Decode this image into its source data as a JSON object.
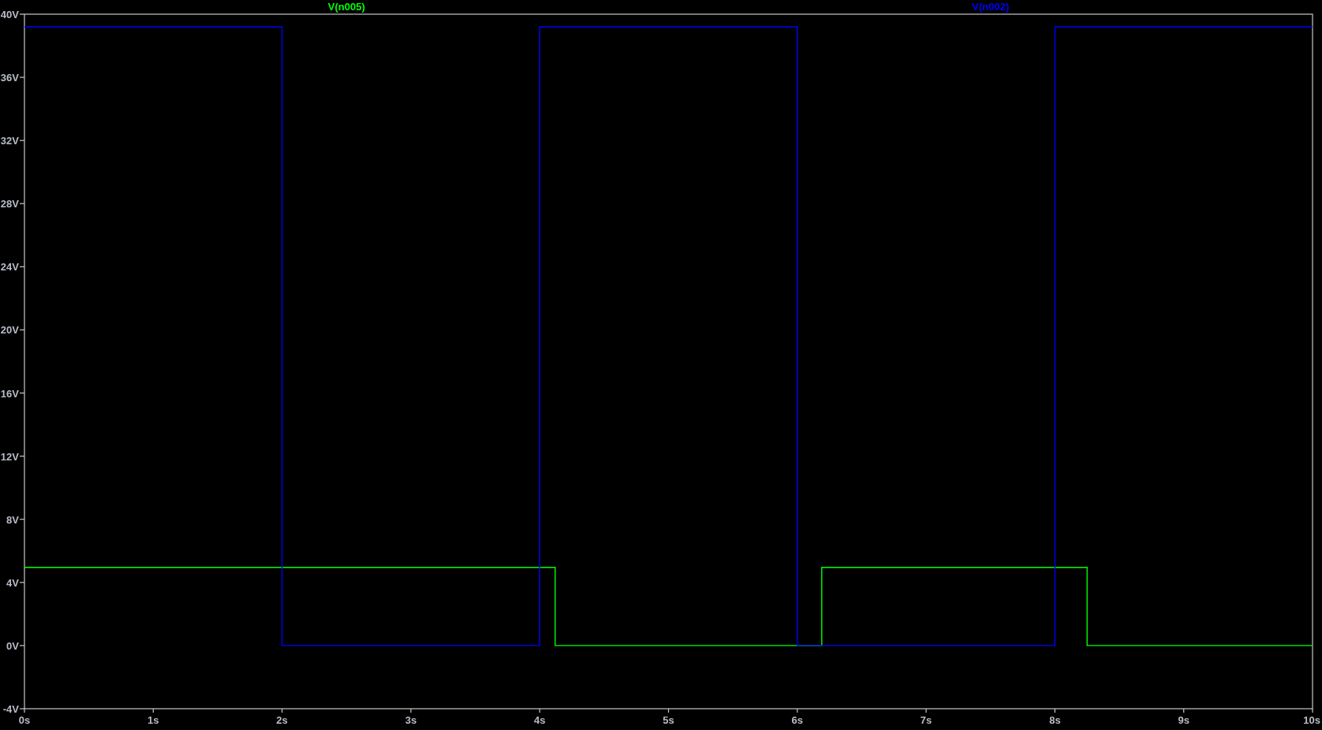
{
  "plot": {
    "chart_data": {
      "type": "line",
      "x": [
        0,
        2,
        2,
        4,
        4,
        4.12,
        4.12,
        6,
        6,
        6.19,
        6.19,
        8,
        8,
        8.25,
        8.25,
        10
      ],
      "series": [
        {
          "name": "V(n005)",
          "color": "#00ff00",
          "values": [
            4.95,
            4.95,
            4.95,
            4.95,
            4.95,
            4.95,
            0,
            0,
            0,
            0,
            4.95,
            4.95,
            4.95,
            4.95,
            0,
            0
          ]
        },
        {
          "name": "V(n002)",
          "color": "#0000ff",
          "values": [
            39.2,
            39.2,
            0,
            0,
            39.2,
            39.2,
            39.2,
            39.2,
            0,
            0,
            0,
            0,
            39.2,
            39.2,
            39.2,
            39.2
          ]
        }
      ],
      "xlim": [
        0,
        10
      ],
      "ylim": [
        -4,
        40
      ],
      "xticks": [
        {
          "value": 0,
          "label": "0s"
        },
        {
          "value": 1,
          "label": "1s"
        },
        {
          "value": 2,
          "label": "2s"
        },
        {
          "value": 3,
          "label": "3s"
        },
        {
          "value": 4,
          "label": "4s"
        },
        {
          "value": 5,
          "label": "5s"
        },
        {
          "value": 6,
          "label": "6s"
        },
        {
          "value": 7,
          "label": "7s"
        },
        {
          "value": 8,
          "label": "8s"
        },
        {
          "value": 9,
          "label": "9s"
        },
        {
          "value": 10,
          "label": "10s"
        }
      ],
      "yticks": [
        {
          "value": -4,
          "label": "-4V"
        },
        {
          "value": 0,
          "label": "0V"
        },
        {
          "value": 4,
          "label": "4V"
        },
        {
          "value": 8,
          "label": "8V"
        },
        {
          "value": 12,
          "label": "12V"
        },
        {
          "value": 16,
          "label": "16V"
        },
        {
          "value": 20,
          "label": "20V"
        },
        {
          "value": 24,
          "label": "24V"
        },
        {
          "value": 28,
          "label": "28V"
        },
        {
          "value": 32,
          "label": "32V"
        },
        {
          "value": 36,
          "label": "36V"
        },
        {
          "value": 40,
          "label": "40V"
        }
      ]
    }
  }
}
